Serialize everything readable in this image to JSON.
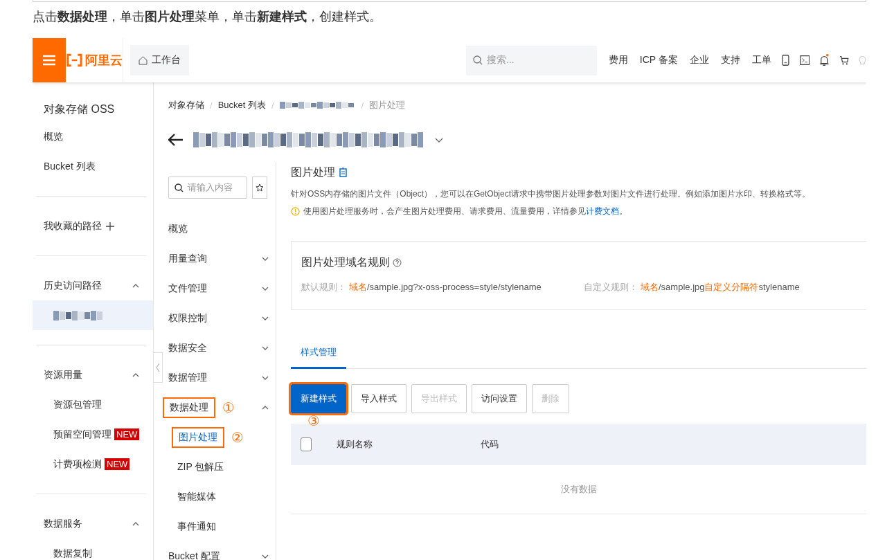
{
  "instruction": "点击**数据处理**，单击**图片处理**菜单，单击**新建样式**，创建样式。",
  "topbar": {
    "logo": "阿里云",
    "workbench": "工作台",
    "search_placeholder": "搜索...",
    "links": [
      "费用",
      "ICP 备案",
      "企业",
      "支持",
      "工单"
    ],
    "notification_dot": true
  },
  "sidebar": {
    "title": "对象存储 OSS",
    "sections": [
      {
        "items": [
          {
            "label": "概览",
            "selected": false
          },
          {
            "label": "Bucket 列表",
            "selected": false
          }
        ]
      },
      {
        "header": "我收藏的路径",
        "kind": "add"
      },
      {
        "header": "历史访问路径",
        "kind": "collapsible",
        "expanded": true,
        "items": [
          {
            "kind": "blurred",
            "selected": true
          }
        ]
      },
      {
        "header": "资源用量",
        "kind": "collapsible",
        "expanded": true,
        "items": [
          {
            "label": "资源包管理",
            "selected": false
          },
          {
            "label": "预留空间管理",
            "badge": "NEW",
            "selected": false
          },
          {
            "label": "计费项检测",
            "badge": "NEW",
            "selected": false
          }
        ]
      },
      {
        "header": "数据服务",
        "kind": "collapsible",
        "expanded": true,
        "items": [
          {
            "label": "数据复制",
            "selected": false
          }
        ]
      }
    ]
  },
  "breadcrumb": {
    "separator": "/",
    "items": [
      {
        "kind": "text",
        "label": "对象存储",
        "current": false
      },
      {
        "kind": "text",
        "label": "Bucket 列表",
        "current": false
      },
      {
        "kind": "blurred"
      },
      {
        "kind": "text",
        "label": "图片处理",
        "current": true
      }
    ]
  },
  "nav": {
    "search_placeholder": "请输入内容",
    "items": [
      {
        "label": "概览",
        "kind": "leaf",
        "selected": false
      },
      {
        "label": "用量查询",
        "kind": "group",
        "expanded": false
      },
      {
        "label": "文件管理",
        "kind": "group",
        "expanded": false
      },
      {
        "label": "权限控制",
        "kind": "group",
        "expanded": false
      },
      {
        "label": "数据安全",
        "kind": "group",
        "expanded": false
      },
      {
        "label": "数据管理",
        "kind": "group",
        "expanded": false
      },
      {
        "label": "数据处理",
        "kind": "group",
        "expanded": true,
        "annotation": "①",
        "children": [
          {
            "label": "图片处理",
            "selected": true,
            "annotation": "②"
          },
          {
            "label": "ZIP 包解压",
            "selected": false
          },
          {
            "label": "智能媒体",
            "selected": false
          },
          {
            "label": "事件通知",
            "selected": false
          }
        ]
      },
      {
        "label": "Bucket 配置",
        "kind": "group",
        "expanded": false
      }
    ]
  },
  "content": {
    "title": "图片处理",
    "description": "针对OSS内存储的图片文件（Object），您可以在GetObject请求中携带图片处理参数对图片文件进行处理。例如添加图片水印、转换格式等。",
    "notice": {
      "text": "使用图片处理服务时，会产生图片处理费用、请求费用、流量费用，详情参见",
      "link": "计费文档",
      "end": "。"
    },
    "rules_card": {
      "title": "图片处理域名规则",
      "rules": [
        {
          "label": "默认规则：",
          "segments": [
            {
              "text": "域名",
              "highlight": true
            },
            {
              "text": "/sample.jpg?x-oss-process=style/stylename",
              "highlight": false
            }
          ]
        },
        {
          "label": "自定义规则：",
          "segments": [
            {
              "text": "域名",
              "highlight": true
            },
            {
              "text": "/sample.jpg",
              "highlight": false
            },
            {
              "text": "自定义分隔符",
              "highlight": true
            },
            {
              "text": "stylename",
              "highlight": false
            }
          ]
        }
      ]
    },
    "tabs": [
      {
        "label": "样式管理",
        "selected": true
      }
    ],
    "buttons": [
      {
        "label": "新建样式",
        "kind": "primary",
        "disabled": false,
        "annotation": "③"
      },
      {
        "label": "导入样式",
        "kind": "normal",
        "disabled": false
      },
      {
        "label": "导出样式",
        "kind": "normal",
        "disabled": true
      },
      {
        "label": "访问设置",
        "kind": "normal",
        "disabled": false
      },
      {
        "label": "删除",
        "kind": "normal",
        "disabled": true
      }
    ],
    "table": {
      "select_all_checked": false,
      "columns": [
        "规则名称",
        "代码"
      ],
      "empty_text": "没有数据"
    }
  }
}
